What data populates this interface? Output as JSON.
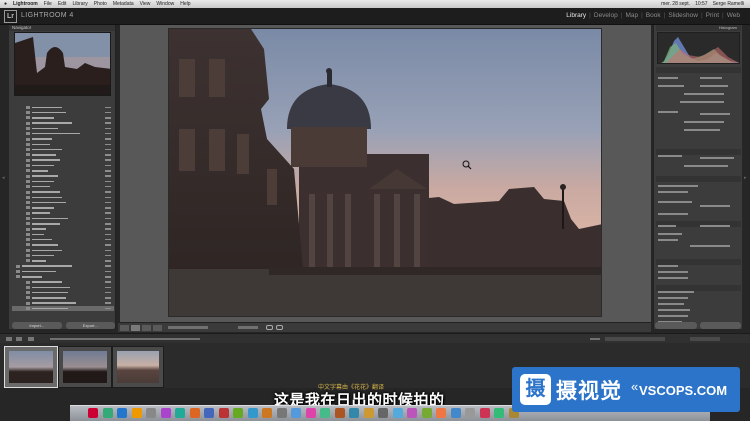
{
  "menubar": {
    "items": [
      "Lightroom",
      "File",
      "Edit",
      "Library",
      "Photo",
      "Metadata",
      "View",
      "Window",
      "Help"
    ],
    "right": [
      "mer. 28 sept.",
      "10:57",
      "Serge Ramelli"
    ]
  },
  "app": {
    "logo": "Lr",
    "title": "LIGHTROOM 4"
  },
  "modules": {
    "items": [
      "Library",
      "Develop",
      "Map",
      "Book",
      "Slideshow",
      "Print",
      "Web"
    ],
    "active": "Library",
    "sep": "|"
  },
  "left_panel": {
    "navigator_label": "Navigator",
    "import_label": "Import...",
    "export_label": "Export..."
  },
  "right_panel": {
    "histogram_label": "Histogram"
  },
  "subtitle": {
    "main": "这是我在日出的时候拍的",
    "top": "中文字幕由《花花》翻译"
  },
  "watermark": {
    "badge": "摄",
    "cn": "摄视觉",
    "en": "VSCOPS.COM",
    "chev": "«"
  },
  "colors": {
    "accent": "#2b74c9",
    "panel": "#3c3c3c",
    "center": "#585858"
  }
}
